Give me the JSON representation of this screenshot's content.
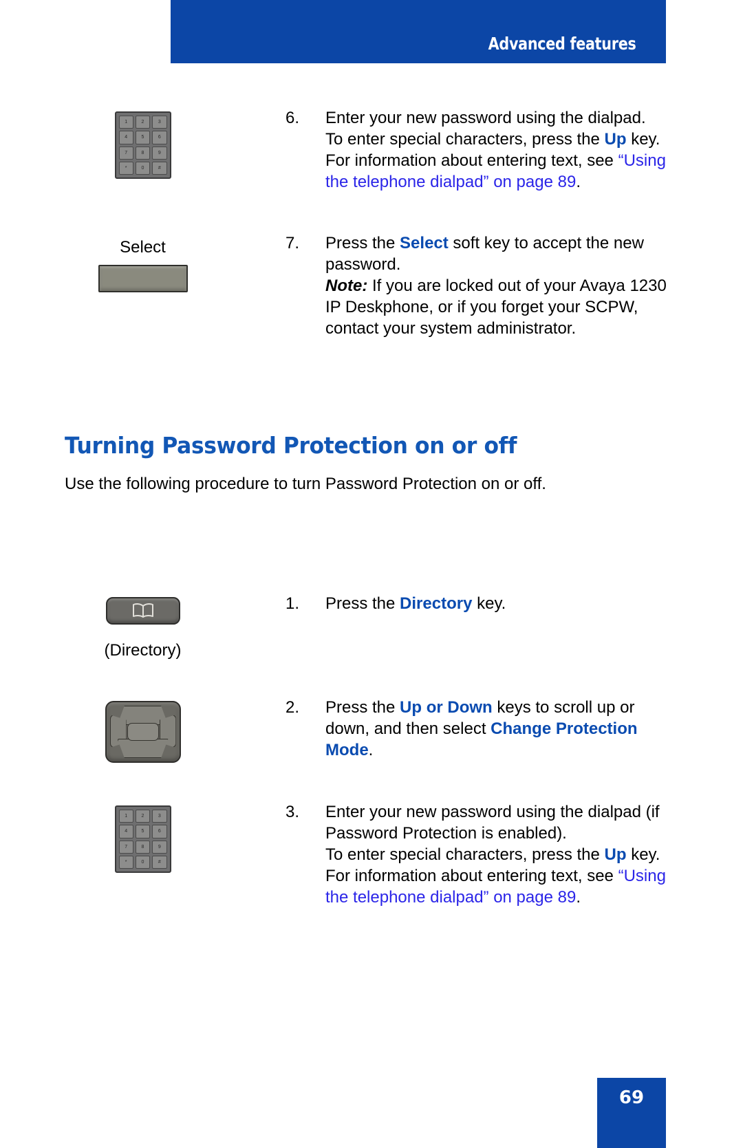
{
  "header": {
    "title": "Advanced features",
    "bar_color": "#0c46a6"
  },
  "colors": {
    "header_blue": "#0c46a6",
    "keyword_blue": "#0a4bb0",
    "link_blue": "#2b25e8",
    "heading_blue": "#1257b5",
    "key_grey": "#6b6a66"
  },
  "steps_top": [
    {
      "number": "6.",
      "art": "dialpad-image",
      "text_runs": [
        {
          "t": "Enter your new password using the dialpad. To enter special characters, press the ",
          "style": "plain"
        },
        {
          "t": "Up",
          "style": "keyword"
        },
        {
          "t": " key. For information about entering text, see ",
          "style": "plain"
        },
        {
          "t": "“Using the telephone dialpad” on page 89",
          "style": "link"
        },
        {
          "t": ".",
          "style": "plain"
        }
      ]
    },
    {
      "number": "7.",
      "art": "softkey-image",
      "softkey_label": "Select",
      "text_runs": [
        {
          "t": "Press the ",
          "style": "plain"
        },
        {
          "t": "Select",
          "style": "keyword"
        },
        {
          "t": " soft key to accept the new password.",
          "style": "plain"
        }
      ],
      "note_runs": [
        {
          "t": "Note:",
          "style": "note"
        },
        {
          "t": " If you are locked out of your Avaya 1230 IP Deskphone, or if you forget your SCPW, contact your system administrator.",
          "style": "plain"
        }
      ]
    }
  ],
  "section": {
    "heading": "Turning Password Protection on or off",
    "intro": "Use the following procedure to turn Password Protection on or off."
  },
  "steps_bottom": [
    {
      "number": "1.",
      "art": "directory-key-image",
      "art_caption": "(Directory)",
      "text_runs": [
        {
          "t": "Press the ",
          "style": "plain"
        },
        {
          "t": "Directory",
          "style": "keyword"
        },
        {
          "t": " key.",
          "style": "plain"
        }
      ]
    },
    {
      "number": "2.",
      "art": "navigation-cluster-image",
      "text_runs": [
        {
          "t": "Press the ",
          "style": "plain"
        },
        {
          "t": "Up or Down",
          "style": "keyword"
        },
        {
          "t": " keys to scroll up or down, and then select ",
          "style": "plain"
        },
        {
          "t": "Change Protection Mode",
          "style": "keyword"
        },
        {
          "t": ".",
          "style": "plain"
        }
      ]
    },
    {
      "number": "3.",
      "art": "dialpad-image",
      "text_runs": [
        {
          "t": "Enter your new password using the dialpad (if Password Protection is enabled).",
          "style": "plain"
        },
        {
          "t": "\n",
          "style": "break"
        },
        {
          "t": "To enter special characters, press the ",
          "style": "plain"
        },
        {
          "t": "Up",
          "style": "keyword"
        },
        {
          "t": " key. For information about entering text, see ",
          "style": "plain"
        },
        {
          "t": "“Using the telephone dialpad” on page 89",
          "style": "link"
        },
        {
          "t": ".",
          "style": "plain"
        }
      ]
    }
  ],
  "dialpad_keys": [
    "1",
    "2",
    "3",
    "4",
    "5",
    "6",
    "7",
    "8",
    "9",
    "*",
    "0",
    "#"
  ],
  "footer": {
    "page_number": "69"
  }
}
